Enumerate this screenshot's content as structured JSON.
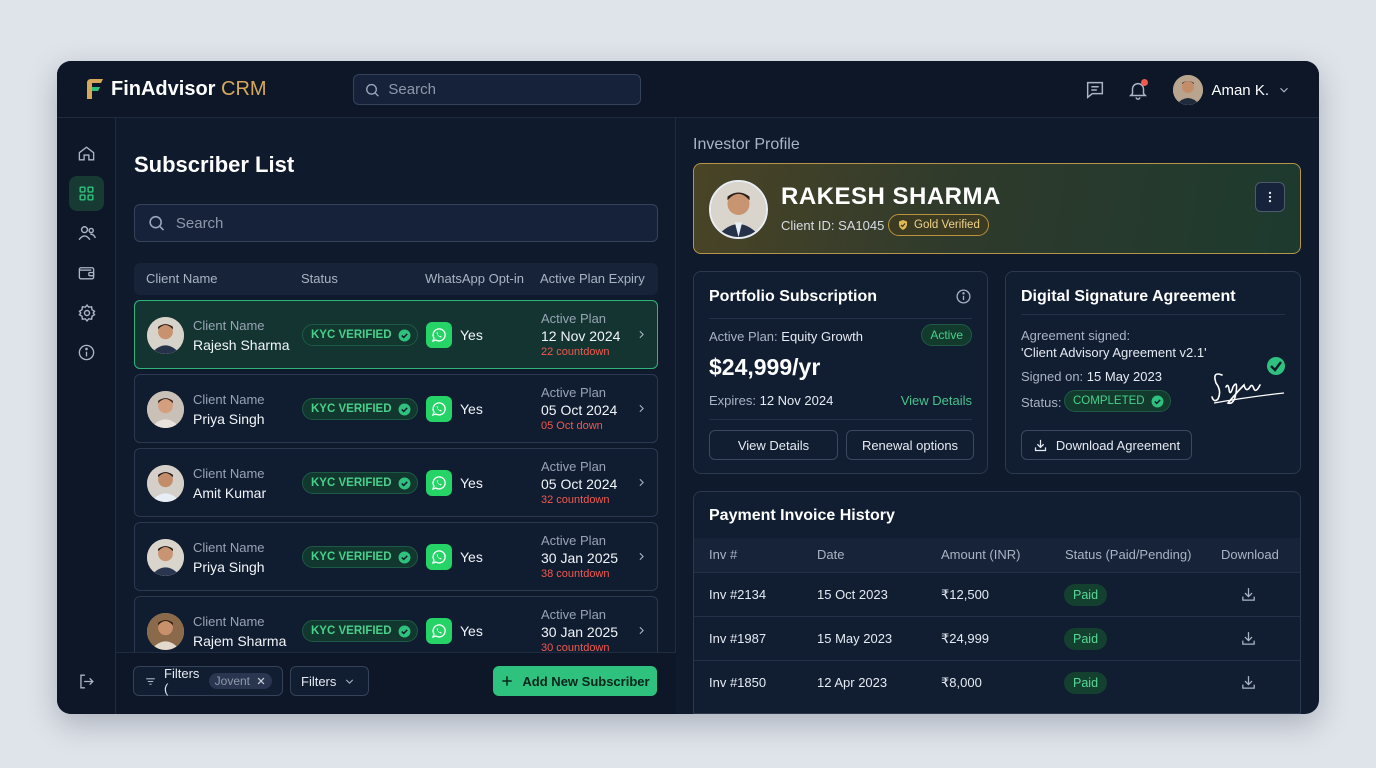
{
  "app": {
    "name": "FinAdvisor",
    "name_accent": "CRM"
  },
  "header": {
    "search_placeholder": "Search",
    "user_name": "Aman K."
  },
  "sidebar": {
    "items": [
      "home-icon",
      "dashboard-icon",
      "users-icon",
      "wallet-icon",
      "settings-icon",
      "info-icon"
    ],
    "active": "dashboard-icon",
    "bottom": "logout-icon"
  },
  "subscriber_list": {
    "title": "Subscriber List",
    "search_placeholder": "Search",
    "columns": [
      "Client Name",
      "Status",
      "WhatsApp Opt-in",
      "Active Plan Expiry"
    ],
    "rows": [
      {
        "label": "Client Name",
        "name": "Rajesh Sharma",
        "status": "KYC VERIFIED",
        "whatsapp": "Yes",
        "plan_label": "Active Plan",
        "plan_date": "12 Nov 2024",
        "countdown": "22 countdown",
        "selected": true
      },
      {
        "label": "Client Name",
        "name": "Priya Singh",
        "status": "KYC VERIFIED",
        "whatsapp": "Yes",
        "plan_label": "Active Plan",
        "plan_date": "05 Oct 2024",
        "countdown": "05 Oct down",
        "selected": false
      },
      {
        "label": "Client Name",
        "name": "Amit Kumar",
        "status": "KYC VERIFIED",
        "whatsapp": "Yes",
        "plan_label": "Active Plan",
        "plan_date": "05 Oct 2024",
        "countdown": "32 countdown",
        "selected": false
      },
      {
        "label": "Client Name",
        "name": "Priya Singh",
        "status": "KYC VERIFIED",
        "whatsapp": "Yes",
        "plan_label": "Active Plan",
        "plan_date": "30 Jan 2025",
        "countdown": "38 countdown",
        "selected": false
      },
      {
        "label": "Client Name",
        "name": "Rajem Sharma",
        "status": "KYC VERIFIED",
        "whatsapp": "Yes",
        "plan_label": "Active Plan",
        "plan_date": "30 Jan 2025",
        "countdown": "30 countdown",
        "selected": false
      }
    ],
    "footer": {
      "filter1_label": "Filters (",
      "filter1_chip": "Jovent",
      "filter2_label": "Filters",
      "add_label": "Add New Subscriber"
    }
  },
  "profile": {
    "section_title": "Investor Profile",
    "name": "RAKESH SHARMA",
    "client_id_label": "Client ID:",
    "client_id": "SA1045",
    "badge": "Gold Verified"
  },
  "portfolio": {
    "title": "Portfolio Subscription",
    "plan_label": "Active Plan:",
    "plan": "Equity Growth",
    "status": "Active",
    "price": "$24,999/yr",
    "expires_label": "Expires:",
    "expires": "12 Nov 2024",
    "view_link": "View Details",
    "btn_view": "View Details",
    "btn_renew": "Renewal options"
  },
  "signature": {
    "title": "Digital Signature Agreement",
    "signed_label": "Agreement signed:",
    "agreement": "'Client Advisory Agreement v2.1'",
    "signed_on_label": "Signed on:",
    "signed_on": "15 May 2023",
    "status_label": "Status:",
    "status": "COMPLETED",
    "download": "Download Agreement"
  },
  "invoices": {
    "title": "Payment Invoice History",
    "columns": [
      "Inv #",
      "Date",
      "Amount (INR)",
      "Status (Paid/Pending)",
      "Download"
    ],
    "rows": [
      {
        "inv": "Inv #2134",
        "date": "15 Oct 2023",
        "amount": "₹12,500",
        "status": "Paid"
      },
      {
        "inv": "Inv #1987",
        "date": "15 May 2023",
        "amount": "₹24,999",
        "status": "Paid"
      },
      {
        "inv": "Inv #1850",
        "date": "12 Apr 2023",
        "amount": "₹8,000",
        "status": "Paid"
      }
    ]
  },
  "colors": {
    "accent_green": "#2ec27e",
    "gold": "#d7a85a",
    "background": "#0f1a2c",
    "danger": "#f05a4f"
  }
}
